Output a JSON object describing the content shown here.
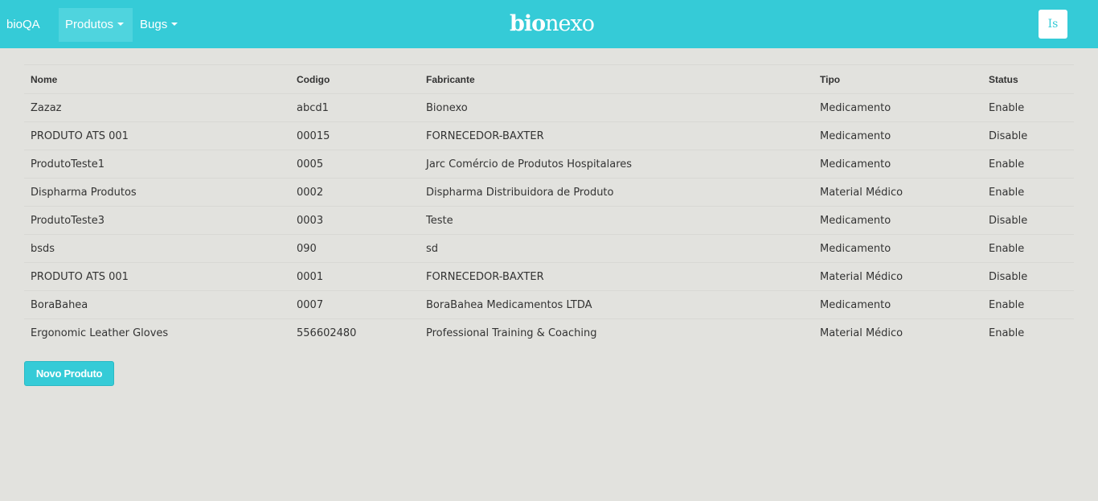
{
  "navbar": {
    "brand": "bioQA",
    "menu": [
      {
        "label": "Produtos",
        "active": true
      },
      {
        "label": "Bugs",
        "active": false
      }
    ],
    "logo": {
      "part1": "bio",
      "part2": "nexo"
    },
    "user_initials": "Is",
    "accent_color": "#35cbd7"
  },
  "table": {
    "columns": [
      "Nome",
      "Codigo",
      "Fabricante",
      "Tipo",
      "Status"
    ],
    "rows": [
      [
        "Zazaz",
        "abcd1",
        "Bionexo",
        "Medicamento",
        "Enable"
      ],
      [
        "PRODUTO ATS 001",
        "00015",
        "FORNECEDOR-BAXTER",
        "Medicamento",
        "Disable"
      ],
      [
        "ProdutoTeste1",
        "0005",
        "Jarc Comércio de Produtos Hospitalares",
        "Medicamento",
        "Enable"
      ],
      [
        "Dispharma Produtos",
        "0002",
        "Dispharma Distribuidora de Produto",
        "Material Médico",
        "Enable"
      ],
      [
        "ProdutoTeste3",
        "0003",
        "Teste",
        "Medicamento",
        "Disable"
      ],
      [
        "bsds",
        "090",
        "sd",
        "Medicamento",
        "Enable"
      ],
      [
        "PRODUTO ATS 001",
        "0001",
        "FORNECEDOR-BAXTER",
        "Material Médico",
        "Disable"
      ],
      [
        "BoraBahea",
        "0007",
        "BoraBahea Medicamentos LTDA",
        "Medicamento",
        "Enable"
      ],
      [
        "Ergonomic Leather Gloves",
        "556602480",
        "Professional Training & Coaching",
        "Material Médico",
        "Enable"
      ]
    ]
  },
  "actions": {
    "new_product_label": "Novo Produto"
  }
}
